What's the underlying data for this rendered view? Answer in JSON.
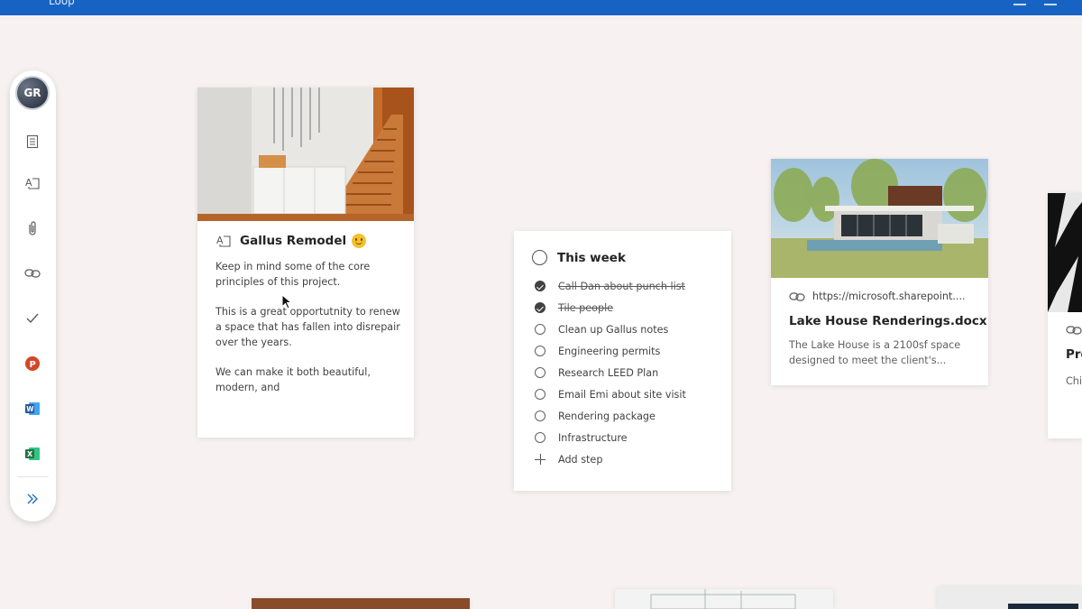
{
  "topbar": {
    "app_name": "Loop"
  },
  "toolbar": {
    "avatar_initials": "GR",
    "tools": [
      {
        "name": "page-icon"
      },
      {
        "name": "text-box-icon"
      },
      {
        "name": "attachment-icon"
      },
      {
        "name": "link-icon"
      },
      {
        "name": "checkmark-icon"
      },
      {
        "name": "powerpoint-icon"
      },
      {
        "name": "word-icon"
      },
      {
        "name": "excel-icon"
      }
    ],
    "expand_icon": "chevron-double-right-icon"
  },
  "note_card": {
    "title": "Gallus Remodel",
    "paragraphs": [
      "Keep in mind some of the core principles of this project.",
      "This is a great opportutnity to renew a space that has fallen into disrepair over the years.",
      "We can make it both beautiful, modern, and"
    ]
  },
  "todo_card": {
    "title": "This week",
    "items": [
      {
        "text": "Call Dan about punch list",
        "done": true
      },
      {
        "text": "Tile people",
        "done": true
      },
      {
        "text": "Clean up Gallus notes",
        "done": false
      },
      {
        "text": "Engineering permits",
        "done": false
      },
      {
        "text": "Research LEED Plan",
        "done": false
      },
      {
        "text": "Email Emi about site visit",
        "done": false
      },
      {
        "text": "Rendering package",
        "done": false
      },
      {
        "text": "Infrastructure",
        "done": false
      }
    ],
    "add_step_label": "Add step"
  },
  "doc_card": {
    "url": "https://microsoft.sharepoint....",
    "title": "Lake House Renderings.docx",
    "description": "The Lake House is a 2100sf space designed to meet the client's..."
  },
  "partial_card": {
    "title": "Pro",
    "subtitle": "Chi"
  },
  "colors": {
    "topbar": "#1763c4",
    "canvas": "#f7f2f1",
    "powerpoint": "#d24726",
    "word": "#2b579a",
    "excel": "#217346"
  }
}
